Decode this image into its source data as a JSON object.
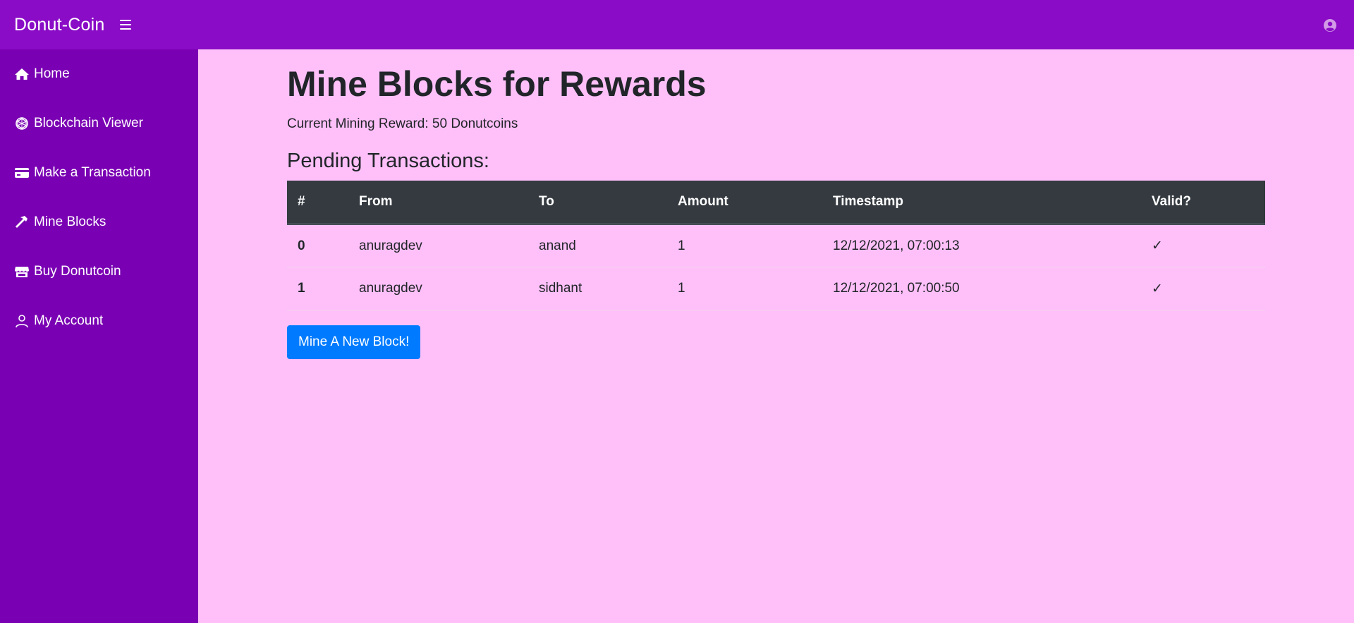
{
  "header": {
    "brand": "Donut-Coin"
  },
  "sidebar": {
    "items": [
      {
        "label": "Home",
        "icon": "home-icon"
      },
      {
        "label": "Blockchain Viewer",
        "icon": "cube-network-icon"
      },
      {
        "label": "Make a Transaction",
        "icon": "credit-card-icon"
      },
      {
        "label": "Mine Blocks",
        "icon": "hammer-icon"
      },
      {
        "label": "Buy Donutcoin",
        "icon": "store-icon"
      },
      {
        "label": "My Account",
        "icon": "user-icon"
      }
    ]
  },
  "main": {
    "title": "Mine Blocks for Rewards",
    "reward_text": "Current Mining Reward: 50 Donutcoins",
    "pending_heading": "Pending Transactions:",
    "table": {
      "headers": [
        "#",
        "From",
        "To",
        "Amount",
        "Timestamp",
        "Valid?"
      ],
      "rows": [
        [
          "0",
          "anuragdev",
          "anand",
          "1",
          "12/12/2021, 07:00:13",
          "✓"
        ],
        [
          "1",
          "anuragdev",
          "sidhant",
          "1",
          "12/12/2021, 07:00:50",
          "✓"
        ]
      ]
    },
    "mine_button": "Mine A New Block!"
  },
  "colors": {
    "topbar": "#8a0cc6",
    "sidebar": "#7a00b3",
    "background": "#ffc0f9",
    "table_header": "#343a40",
    "button": "#007bff"
  }
}
